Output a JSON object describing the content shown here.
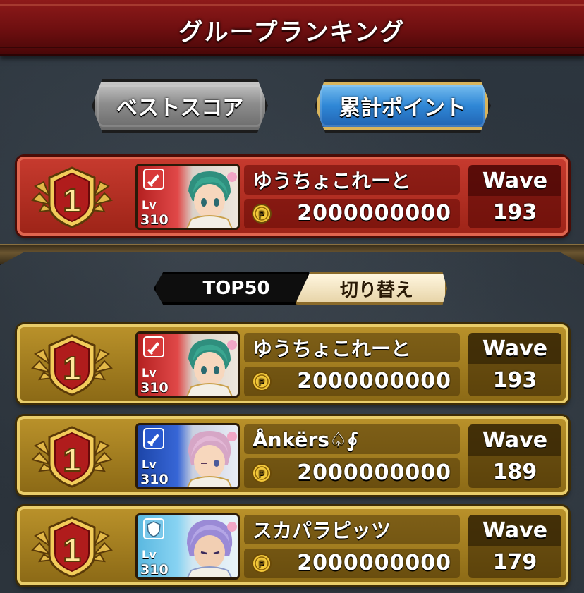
{
  "header": {
    "title": "グループランキング"
  },
  "modes": {
    "best_score": "ベストスコア",
    "total_points": "累計ポイント",
    "active": "total_points"
  },
  "my_rank": {
    "rank": "1",
    "level_label": "Lv",
    "level": "310",
    "name": "ゆうちょこれーと",
    "score": "2000000000",
    "wave_label": "Wave",
    "wave": "193",
    "portrait_color": "red"
  },
  "toggle": {
    "left_label": "TOP50",
    "right_label": "切り替え"
  },
  "ranking": [
    {
      "rank": "1",
      "level_label": "Lv",
      "level": "310",
      "name": "ゆうちょこれーと",
      "score": "2000000000",
      "wave_label": "Wave",
      "wave": "193",
      "portrait_color": "red"
    },
    {
      "rank": "1",
      "level_label": "Lv",
      "level": "310",
      "name": "Ånkërs♤∮",
      "score": "2000000000",
      "wave_label": "Wave",
      "wave": "189",
      "portrait_color": "blue"
    },
    {
      "rank": "1",
      "level_label": "Lv",
      "level": "310",
      "name": "スカパラピッツ",
      "score": "2000000000",
      "wave_label": "Wave",
      "wave": "179",
      "portrait_color": "cyan"
    }
  ],
  "colors": {
    "header_red": "#7a1212",
    "active_button_blue": "#2f87d6",
    "row_red": "#b02e22",
    "row_gold": "#a47f20"
  }
}
